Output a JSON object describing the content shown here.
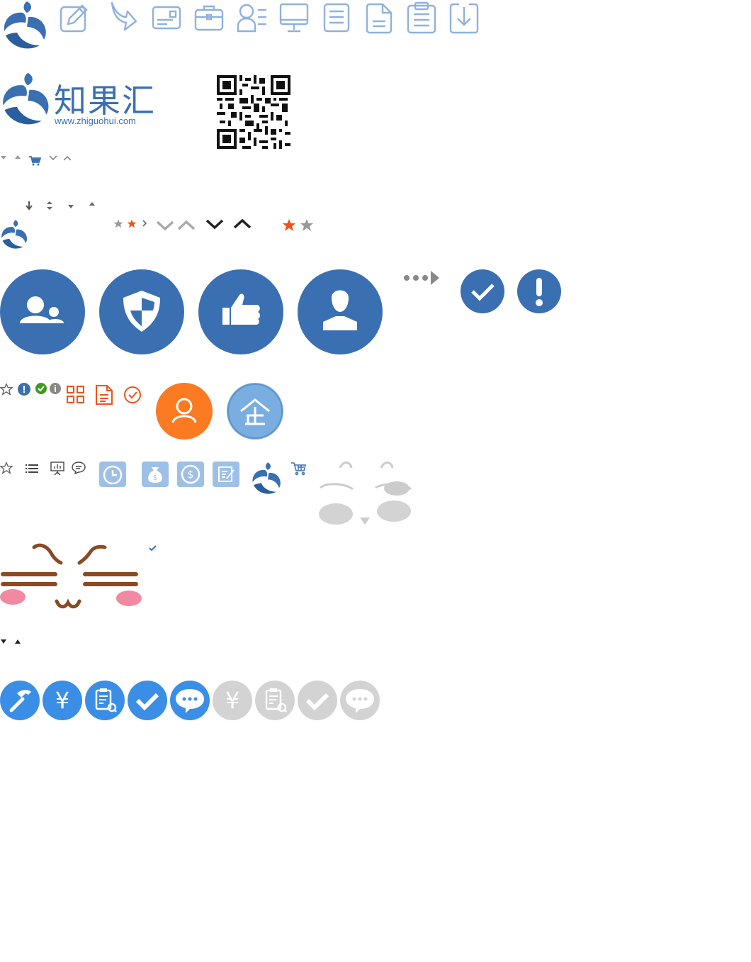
{
  "colors": {
    "brand_blue": "#3a6fb2",
    "line_blue": "#8fb1de",
    "orange_red": "#f0521c",
    "orange": "#fb7a22",
    "light_blue": "#7aaee0",
    "tile_blue": "#9ec0e7",
    "bright_blue": "#3b8ee6",
    "gray": "#d3d3d3",
    "brown": "#8b4a24",
    "pink": "#f08aa0",
    "green": "#3b9b1c"
  },
  "brand": {
    "name": "知果汇",
    "url": "www.zhiguohui.com"
  },
  "sprites": {
    "row1": [
      "brand-logo-icon",
      "edit-icon",
      "forward-arrow-icon",
      "id-card-icon",
      "briefcase-icon",
      "user-list-icon",
      "monitor-icon",
      "document-icon",
      "document-lines-icon",
      "clipboard-icon",
      "download-icon"
    ],
    "row_circles": [
      "group-users-icon",
      "shield-icon",
      "thumbs-up-icon",
      "user-icon"
    ],
    "row_small_circles": [
      "check-circle-icon",
      "exclamation-circle-icon"
    ],
    "row_bottom_blue": [
      "hammer-icon",
      "yen-icon",
      "clipboard-search-icon",
      "check-icon",
      "chat-icon"
    ],
    "row_bottom_gray": [
      "yen-icon",
      "clipboard-search-icon",
      "check-icon",
      "chat-icon"
    ]
  }
}
